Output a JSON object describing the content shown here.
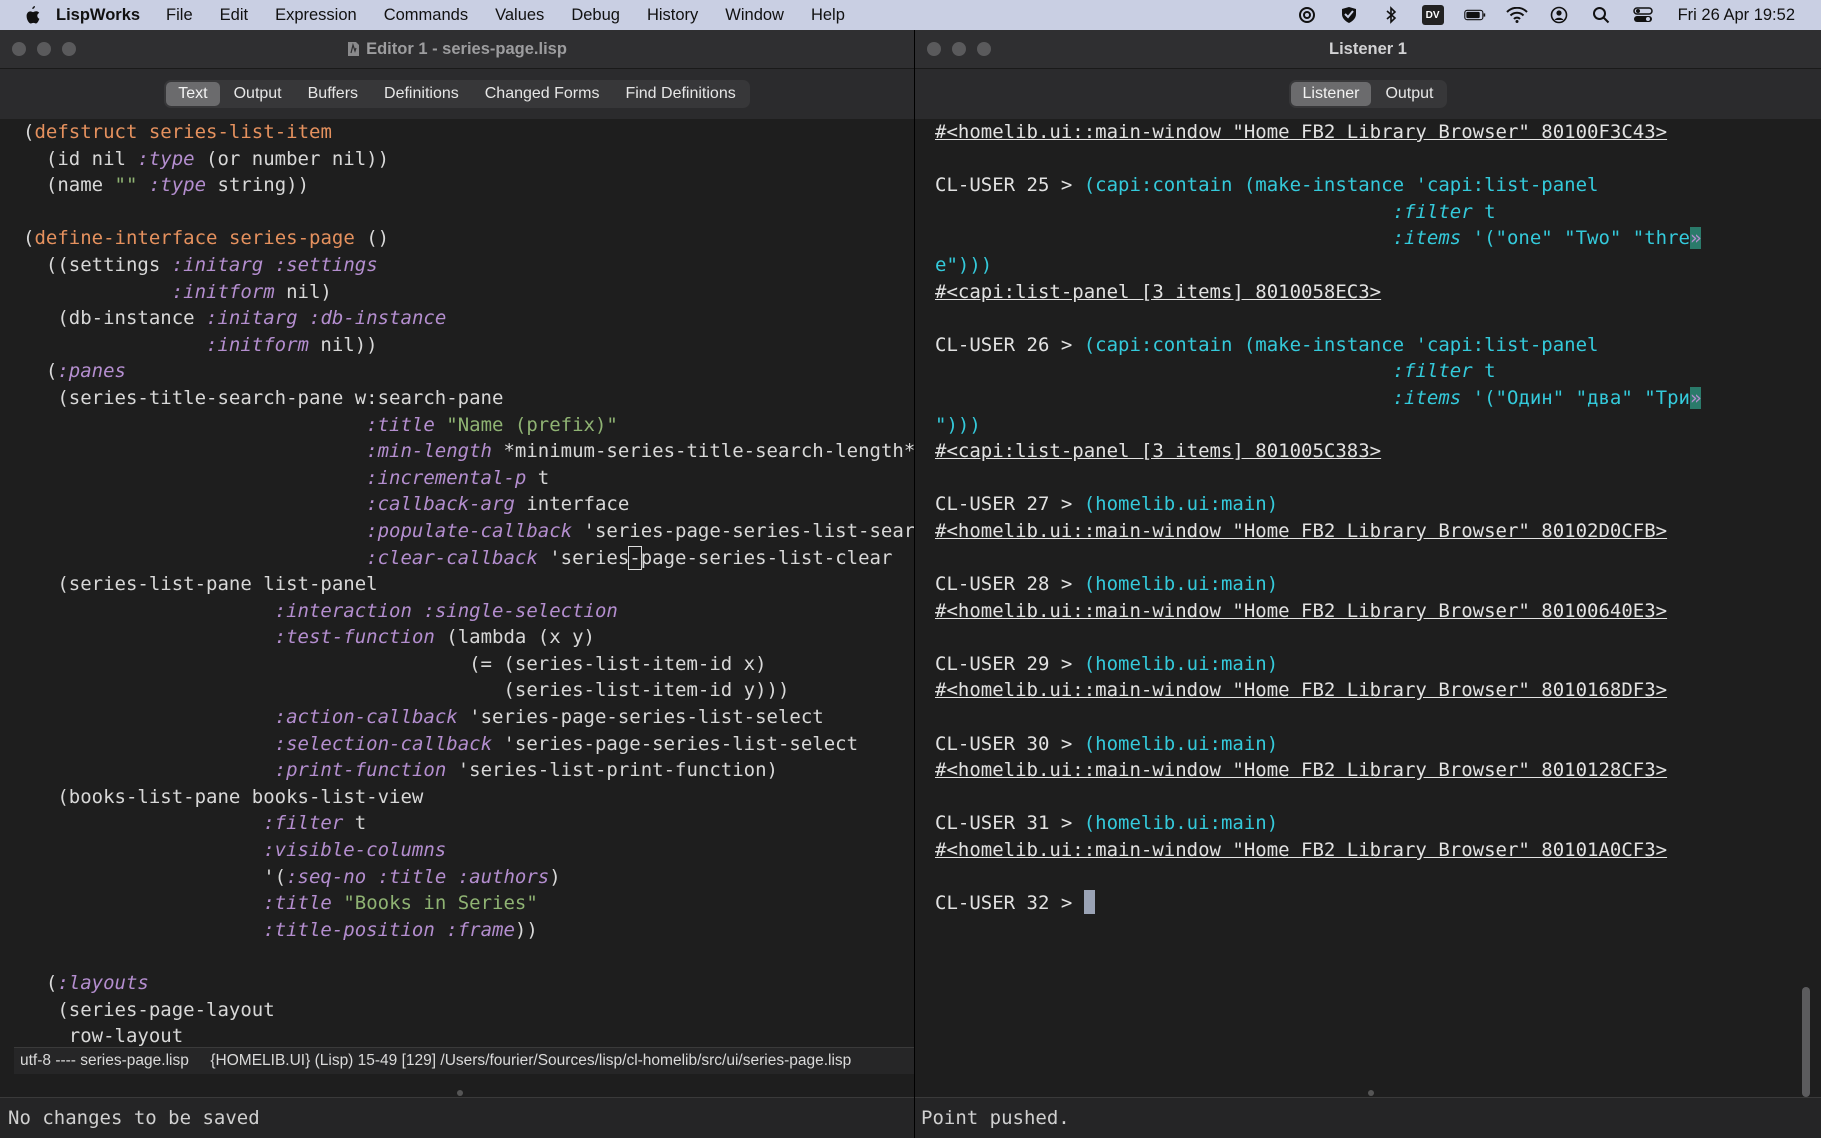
{
  "menubar": {
    "app_name": "LispWorks",
    "items": [
      "File",
      "Edit",
      "Expression",
      "Commands",
      "Values",
      "Debug",
      "History",
      "Window",
      "Help"
    ],
    "status_icons": [
      "at-sign-icon",
      "checkmark-shield-icon",
      "bluetooth-icon",
      "dv-badge-icon",
      "battery-icon",
      "wifi-icon",
      "user-icon",
      "search-icon",
      "control-center-icon"
    ],
    "dv_badge": "DV",
    "clock": "Fri 26 Apr  19:52"
  },
  "editor": {
    "title": "Editor 1 - series-page.lisp",
    "tabs": [
      "Text",
      "Output",
      "Buffers",
      "Definitions",
      "Changed Forms",
      "Find Definitions"
    ],
    "selected_tab": "Text",
    "modeline": "utf-8 ---- series-page.lisp     {HOMELIB.UI} (Lisp) 15-49 [129] /Users/fourier/Sources/lisp/cl-homelib/src/ui/series-page.lisp",
    "echo": "No changes to be saved",
    "code": {
      "l1a": "(",
      "l1b": "defstruct",
      "l1c": " ",
      "l1d": "series-list-item",
      "l2a": "  (id nil ",
      "l2b": ":type",
      "l2c": " (or number nil))",
      "l3a": "  (name ",
      "l3b": "\"\"",
      "l3c": " ",
      "l3d": ":type",
      "l3e": " string))",
      "l5a": "(",
      "l5b": "define-interface",
      "l5c": " ",
      "l5d": "series-page",
      "l5e": " ()",
      "l6a": "  ((settings ",
      "l6b": ":initarg",
      "l6c": " ",
      "l6d": ":settings",
      "l7a": "             ",
      "l7b": ":initform",
      "l7c": " nil)",
      "l8a": "   (db-instance ",
      "l8b": ":initarg",
      "l8c": " ",
      "l8d": ":db-instance",
      "l9a": "                ",
      "l9b": ":initform",
      "l9c": " nil))",
      "l10a": "  (",
      "l10b": ":panes",
      "l11a": "   (series-title-search-pane w:search-pane",
      "l12a": "                              ",
      "l12b": ":title",
      "l12c": " ",
      "l12d": "\"Name (prefix)\"",
      "l13a": "                              ",
      "l13b": ":min-length",
      "l13c": " *minimum-series-title-search-length*",
      "l14a": "                              ",
      "l14b": ":incremental-p",
      "l14c": " t",
      "l15a": "                              ",
      "l15b": ":callback-arg",
      "l15c": " interface",
      "l16a": "                              ",
      "l16b": ":populate-callback",
      "l16c": " 'series-page-series-list-search",
      "l17a": "                              ",
      "l17b": ":clear-callback",
      "l17c": " 'series",
      "l17d": "-",
      "l17e": "page-series-list-clear",
      "l18a": "   (series-list-pane list-panel",
      "l19a": "                      ",
      "l19b": ":interaction",
      "l19c": " ",
      "l19d": ":single-selection",
      "l20a": "                      ",
      "l20b": ":test-function",
      "l20c": " (lambda (x y)",
      "l21a": "                                       (= (series-list-item-id x)",
      "l22a": "                                          (series-list-item-id y)))",
      "l23a": "                      ",
      "l23b": ":action-callback",
      "l23c": " 'series-page-series-list-select",
      "l24a": "                      ",
      "l24b": ":selection-callback",
      "l24c": " 'series-page-series-list-select",
      "l25a": "                      ",
      "l25b": ":print-function",
      "l25c": " 'series-list-print-function)",
      "l26a": "   (books-list-pane books-list-view",
      "l27a": "                     ",
      "l27b": ":filter",
      "l27c": " t",
      "l28a": "                     ",
      "l28b": ":visible-columns",
      "l29a": "                     '(",
      "l29b": ":seq-no",
      "l29c": " ",
      "l29d": ":title",
      "l29e": " ",
      "l29f": ":authors",
      "l29g": ")",
      "l30a": "                     ",
      "l30b": ":title",
      "l30c": " ",
      "l30d": "\"Books in Series\"",
      "l31a": "                     ",
      "l31b": ":title-position",
      "l31c": " ",
      "l31d": ":frame",
      "l31e": "))",
      "l33a": "  (",
      "l33b": ":layouts",
      "l34a": "   (series-page-layout",
      "l35a": "    row-layout"
    }
  },
  "listener": {
    "title": "Listener 1",
    "tabs": [
      "Listener",
      "Output"
    ],
    "selected_tab": "Listener",
    "echo": "Point pushed.",
    "lines": {
      "r24": "#<homelib.ui::main-window \"Home FB2 Library Browser\" 80100F3C43>",
      "p25": "CL-USER 25 > ",
      "c25a": "(capi:contain (make-instance 'capi:list-panel",
      "c25b_pad": "                                        ",
      "c25b": ":filter",
      "c25b2": " t",
      "c25c": ":items",
      "c25c2": " '(\"one\" \"Two\" \"thre",
      "c25c3": "»",
      "c25d": "e\")))",
      "r25": "#<capi:list-panel [3 items] 8010058EC3>",
      "p26": "CL-USER 26 > ",
      "c26a": "(capi:contain (make-instance 'capi:list-panel",
      "c26b": ":filter",
      "c26b2": " t",
      "c26c": ":items",
      "c26c2": " '(\"Один\" \"два\" \"Три",
      "c26c3": "»",
      "c26d": "\")))",
      "r26": "#<capi:list-panel [3 items] 801005C383>",
      "p27": "CL-USER 27 > ",
      "c27": "(homelib.ui:main)",
      "r27": "#<homelib.ui::main-window \"Home FB2 Library Browser\" 80102D0CFB>",
      "p28": "CL-USER 28 > ",
      "c28": "(homelib.ui:main)",
      "r28": "#<homelib.ui::main-window \"Home FB2 Library Browser\" 80100640E3>",
      "p29": "CL-USER 29 > ",
      "c29": "(homelib.ui:main)",
      "r29": "#<homelib.ui::main-window \"Home FB2 Library Browser\" 8010168DF3>",
      "p30": "CL-USER 30 > ",
      "c30": "(homelib.ui:main)",
      "r30": "#<homelib.ui::main-window \"Home FB2 Library Browser\" 8010128CF3>",
      "p31": "CL-USER 31 > ",
      "c31": "(homelib.ui:main)",
      "r31": "#<homelib.ui::main-window \"Home FB2 Library Browser\" 80101A0CF3>",
      "p32": "CL-USER 32 > "
    }
  }
}
